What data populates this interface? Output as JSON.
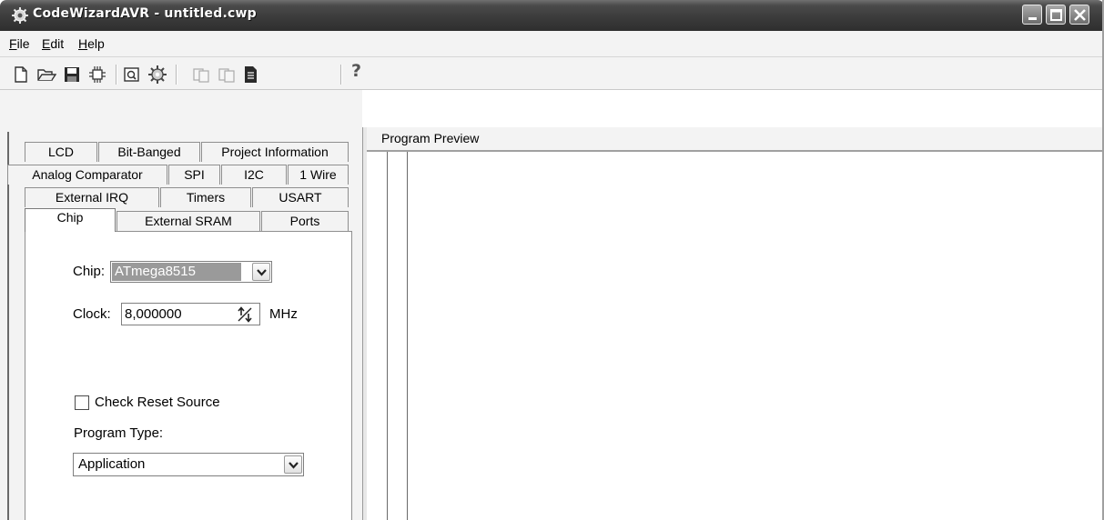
{
  "window": {
    "title": "CodeWizardAVR - untitled.cwp"
  },
  "menu": {
    "items": [
      {
        "mnemonic": "F",
        "rest": "ile"
      },
      {
        "mnemonic": "E",
        "rest": "dit"
      },
      {
        "mnemonic": "H",
        "rest": "elp"
      }
    ]
  },
  "toolbar": {
    "icons": [
      "new-file-icon",
      "open-folder-icon",
      "save-icon",
      "program-chip-icon",
      "preview-icon",
      "generate-icon",
      "copy-icon",
      "paste-icon",
      "document-icon",
      "help-icon"
    ],
    "help_glyph": "?"
  },
  "tabs": {
    "row1": [
      "LCD",
      "Bit-Banged",
      "Project Information"
    ],
    "row2": [
      "Analog Comparator",
      "SPI",
      "I2C",
      "1 Wire"
    ],
    "row3": [
      "External IRQ",
      "Timers",
      "USART"
    ],
    "row4": [
      "Chip",
      "External SRAM",
      "Ports"
    ],
    "active": "Chip"
  },
  "chip_page": {
    "chip_label": "Chip:",
    "chip_value": "ATmega8515",
    "clock_label": "Clock:",
    "clock_value": "8,000000",
    "clock_unit": "MHz",
    "check_reset_label": "Check Reset Source",
    "check_reset_checked": false,
    "program_type_label": "Program Type:",
    "program_type_value": "Application"
  },
  "preview": {
    "title": "Program Preview"
  },
  "colors": {
    "titlebar": "#3a3a3a",
    "panel": "#f3f3f3",
    "selection": "#9a9a9a"
  }
}
